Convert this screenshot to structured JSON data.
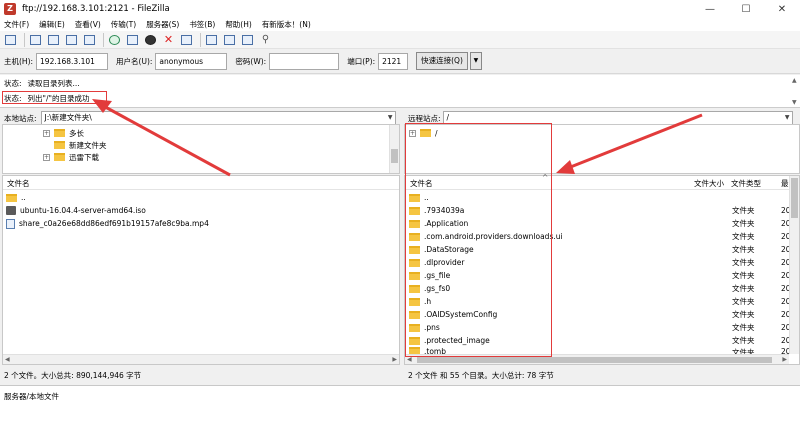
{
  "window": {
    "title": "ftp://192.168.3.101:2121 - FileZilla",
    "app_icon": "Z",
    "minimize": "—",
    "maximize": "☐",
    "close": "✕"
  },
  "menu": [
    "文件(F)",
    "编辑(E)",
    "查看(V)",
    "传输(T)",
    "服务器(S)",
    "书签(B)",
    "帮助(H)",
    "有新版本！(N)"
  ],
  "quickconnect": {
    "host_label": "主机(H):",
    "host_value": "192.168.3.101",
    "user_label": "用户名(U):",
    "user_value": "anonymous",
    "pass_label": "密码(W):",
    "pass_value": "",
    "port_label": "端口(P):",
    "port_value": "2121",
    "connect_button": "快速连接(Q)",
    "dropdown_arrow": "▼"
  },
  "log": {
    "line1_label": "状态:",
    "line1_text": "读取目录列表...",
    "line2_label": "状态:",
    "line2_text": "列出\"/\"的目录成功"
  },
  "local": {
    "site_label": "本地站点:",
    "site_path": "J:\\新建文件夹\\",
    "tree": [
      {
        "name": "多长",
        "expandable": true
      },
      {
        "name": "新建文件夹",
        "expandable": false
      },
      {
        "name": "迅雷下载",
        "expandable": true
      }
    ],
    "col_filename": "文件名",
    "files": [
      {
        "name": "..",
        "type": "folder"
      },
      {
        "name": "ubuntu-16.04.4-server-amd64.iso",
        "type": "iso"
      },
      {
        "name": "share_c0a26e68dd86edf691b19157afe8c9ba.mp4",
        "type": "file"
      }
    ],
    "status": "2 个文件。大小总共: 890,144,946 字节"
  },
  "remote": {
    "site_label": "远程站点:",
    "site_path": "/",
    "tree_root": "/",
    "col_filename": "文件名",
    "col_size": "文件大小",
    "col_type": "文件类型",
    "col_modified": "最",
    "sort_indicator": "^",
    "files": [
      {
        "name": "..",
        "type": ""
      },
      {
        "name": ".7934039a",
        "type": "文件夹",
        "mod": "20"
      },
      {
        "name": ".Application",
        "type": "文件夹",
        "mod": "20"
      },
      {
        "name": ".com.android.providers.downloads.ui",
        "type": "文件夹",
        "mod": "20"
      },
      {
        "name": ".DataStorage",
        "type": "文件夹",
        "mod": "20"
      },
      {
        "name": ".dlprovider",
        "type": "文件夹",
        "mod": "20"
      },
      {
        "name": ".gs_file",
        "type": "文件夹",
        "mod": "20"
      },
      {
        "name": ".gs_fs0",
        "type": "文件夹",
        "mod": "20"
      },
      {
        "name": ".h",
        "type": "文件夹",
        "mod": "20"
      },
      {
        "name": ".OAIDSystemConfig",
        "type": "文件夹",
        "mod": "20"
      },
      {
        "name": ".pns",
        "type": "文件夹",
        "mod": "20"
      },
      {
        "name": ".protected_image",
        "type": "文件夹",
        "mod": "20"
      },
      {
        "name": ".tomb",
        "type": "文件夹",
        "mod": "20"
      }
    ],
    "status": "2 个文件 和 55 个目录。大小总计: 78 字节"
  },
  "queue": {
    "header": "服务器/本地文件"
  },
  "icons": {
    "toolbar": [
      "site-manager-icon",
      "toggle-log-icon",
      "toggle-local-tree-icon",
      "toggle-remote-tree-icon",
      "toggle-queue-icon",
      "refresh-icon",
      "process-queue-icon",
      "cancel-icon",
      "disconnect-icon",
      "reconnect-icon",
      "filter-icon",
      "compare-icon",
      "sync-browse-icon",
      "search-icon"
    ]
  },
  "colors": {
    "annotation_red": "#e23b3b",
    "folder_yellow": "#f5c542"
  }
}
